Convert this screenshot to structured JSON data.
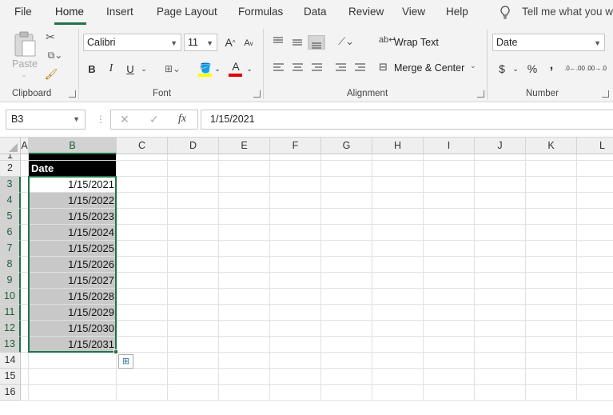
{
  "menu": {
    "tabs": [
      "File",
      "Home",
      "Insert",
      "Page Layout",
      "Formulas",
      "Data",
      "Review",
      "View",
      "Help"
    ],
    "active": "Home",
    "tell_me": "Tell me what you wa"
  },
  "ribbon": {
    "clipboard": {
      "label": "Clipboard",
      "paste": "Paste"
    },
    "font": {
      "label": "Font",
      "name": "Calibri",
      "size": "11",
      "bold": "B",
      "italic": "I",
      "underline": "U",
      "grow": "A",
      "shrink": "A",
      "font_color_letter": "A",
      "highlight_color": "#ffff00",
      "font_color": "#e00000"
    },
    "alignment": {
      "label": "Alignment",
      "wrap": "Wrap Text",
      "merge": "Merge & Center"
    },
    "number": {
      "label": "Number",
      "format": "Date",
      "currency": "$",
      "percent": "%",
      "comma": ",",
      "inc": ".0←.00",
      "dec": ".00→.0"
    }
  },
  "formula_bar": {
    "name_box": "B3",
    "fx": "fx",
    "value": "1/15/2021"
  },
  "columns": [
    "A",
    "B",
    "C",
    "D",
    "E",
    "F",
    "G",
    "H",
    "I",
    "J",
    "K",
    "L"
  ],
  "rows": [
    "1",
    "2",
    "3",
    "4",
    "5",
    "6",
    "7",
    "8",
    "9",
    "10",
    "11",
    "12",
    "13",
    "14",
    "15",
    "16"
  ],
  "header_cell": "Date",
  "dates": [
    "1/15/2021",
    "1/15/2022",
    "1/15/2023",
    "1/15/2024",
    "1/15/2025",
    "1/15/2026",
    "1/15/2027",
    "1/15/2028",
    "1/15/2029",
    "1/15/2030",
    "1/15/2031"
  ],
  "colors": {
    "accent": "#217346",
    "selection": "#c8c8c8"
  }
}
